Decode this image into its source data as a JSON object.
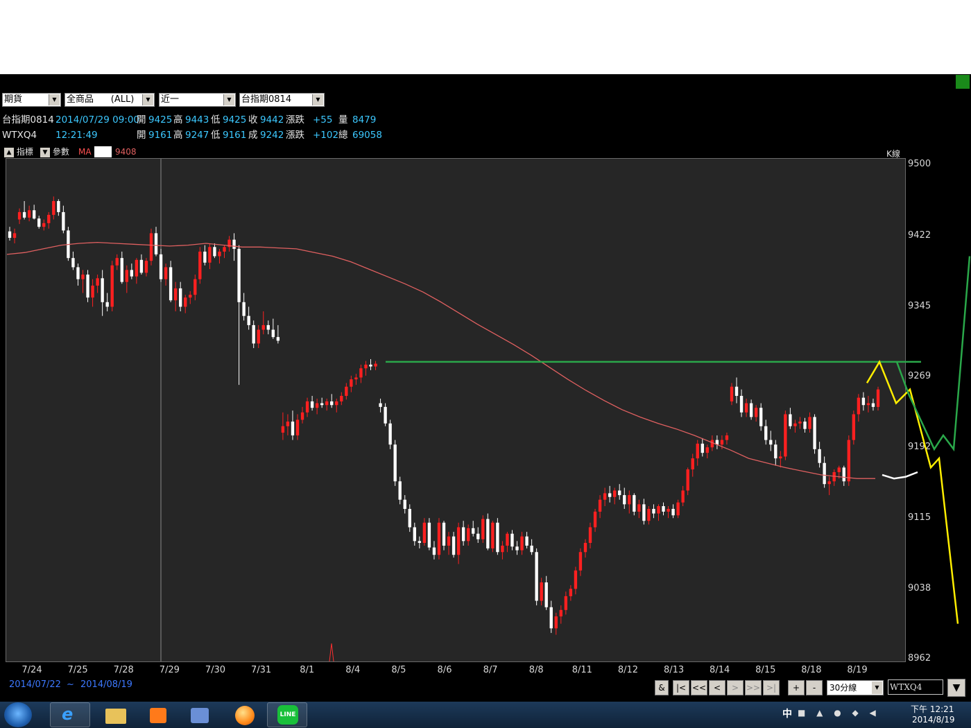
{
  "toolbar": {
    "selects": [
      "期貨",
      "全商品      (ALL)",
      "近一",
      "台指期0814"
    ]
  },
  "quote": {
    "row1": {
      "symbol": "台指期0814",
      "datetime": "2014/07/29 09:00",
      "open_label": "開",
      "open": "9425",
      "high_label": "高",
      "high": "9443",
      "low_label": "低",
      "low": "9425",
      "close_label": "收",
      "close": "9442",
      "chg_label": "漲跌",
      "chg": "+55",
      "vol_label": "量",
      "vol": "8479"
    },
    "row2": {
      "symbol": "WTXQ4",
      "time": "12:21:49",
      "open_label": "開",
      "open": "9161",
      "high_label": "高",
      "high": "9247",
      "low_label": "低",
      "low": "9161",
      "last_label": "成",
      "last": "9242",
      "chg_label": "漲跌",
      "chg": "+102",
      "vol_label": "總",
      "vol": "69058"
    }
  },
  "indicator_bar": {
    "indicator_btn": "指標",
    "param_btn": "參數",
    "ma_label": "MA",
    "ma_value": "9408",
    "kline_label": "K線"
  },
  "chart_data": {
    "type": "candlestick",
    "y_ticks": [
      "9500",
      "9422",
      "9345",
      "9269",
      "9192",
      "9115",
      "9038",
      "8962"
    ],
    "ylim": [
      8962,
      9500
    ],
    "x_ticks": [
      "7/24",
      "7/25",
      "7/28",
      "7/29",
      "7/30",
      "7/31",
      "8/1",
      "8/4",
      "8/5",
      "8/6",
      "8/7",
      "8/8",
      "8/11",
      "8/12",
      "8/13",
      "8/14",
      "8/15",
      "8/18",
      "8/19"
    ],
    "colors": {
      "up": "#ff2020",
      "down": "#ffffff",
      "ma": "#e06060",
      "resistance": "#2aa84a",
      "path_a": "#ffee00",
      "path_b": "#2aa84a",
      "bg": "#262626"
    },
    "candles": [
      [
        9427,
        9432,
        9417,
        9420
      ],
      [
        9420,
        9430,
        9414,
        9425
      ],
      [
        9440,
        9452,
        9435,
        9448
      ],
      [
        9448,
        9460,
        9440,
        9442
      ],
      [
        9442,
        9455,
        9438,
        9450
      ],
      [
        9450,
        9456,
        9440,
        9441
      ],
      [
        9441,
        9444,
        9430,
        9432
      ],
      [
        9432,
        9440,
        9428,
        9436
      ],
      [
        9436,
        9448,
        9430,
        9445
      ],
      [
        9445,
        9465,
        9440,
        9460
      ],
      [
        9460,
        9462,
        9444,
        9448
      ],
      [
        9448,
        9455,
        9425,
        9428
      ],
      [
        9428,
        9432,
        9395,
        9398
      ],
      [
        9398,
        9405,
        9385,
        9388
      ],
      [
        9388,
        9392,
        9368,
        9375
      ],
      [
        9375,
        9385,
        9360,
        9380
      ],
      [
        9380,
        9385,
        9350,
        9355
      ],
      [
        9355,
        9375,
        9345,
        9368
      ],
      [
        9368,
        9380,
        9360,
        9376
      ],
      [
        9376,
        9385,
        9335,
        9350
      ],
      [
        9350,
        9360,
        9340,
        9345
      ],
      [
        9345,
        9395,
        9340,
        9390
      ],
      [
        9390,
        9402,
        9385,
        9398
      ],
      [
        9398,
        9405,
        9370,
        9372
      ],
      [
        9372,
        9390,
        9360,
        9385
      ],
      [
        9385,
        9392,
        9375,
        9378
      ],
      [
        9378,
        9398,
        9370,
        9396
      ],
      [
        9396,
        9402,
        9380,
        9382
      ],
      [
        9382,
        9398,
        9378,
        9395
      ],
      [
        9395,
        9430,
        9390,
        9425
      ],
      [
        9425,
        9432,
        9400,
        9402
      ],
      [
        9402,
        9408,
        9372,
        9375
      ],
      [
        9375,
        9392,
        9368,
        9388
      ],
      [
        9388,
        9395,
        9350,
        9352
      ],
      [
        9352,
        9372,
        9340,
        9365
      ],
      [
        9365,
        9372,
        9340,
        9345
      ],
      [
        9345,
        9358,
        9338,
        9355
      ],
      [
        9355,
        9362,
        9348,
        9358
      ],
      [
        9358,
        9380,
        9352,
        9375
      ],
      [
        9375,
        9410,
        9370,
        9405
      ],
      [
        9405,
        9412,
        9390,
        9393
      ],
      [
        9393,
        9414,
        9386,
        9410
      ],
      [
        9410,
        9414,
        9398,
        9400
      ],
      [
        9400,
        9408,
        9392,
        9405
      ],
      [
        9405,
        9412,
        9398,
        9410
      ],
      [
        9410,
        9422,
        9405,
        9418
      ],
      [
        9418,
        9425,
        9395,
        9408
      ],
      [
        9408,
        9412,
        9260,
        9350
      ],
      [
        9350,
        9360,
        9330,
        9335
      ],
      [
        9335,
        9345,
        9320,
        9325
      ],
      [
        9325,
        9330,
        9300,
        9305
      ],
      [
        9305,
        9325,
        9300,
        9320
      ],
      [
        9320,
        9340,
        9315,
        9325
      ],
      [
        9325,
        9330,
        9315,
        9320
      ],
      [
        9320,
        9332,
        9310,
        9312
      ],
      [
        9312,
        9325,
        9305,
        9308
      ],
      [
        9208,
        9230,
        9200,
        9215
      ],
      [
        9215,
        9228,
        9205,
        9220
      ],
      [
        9220,
        9232,
        9200,
        9205
      ],
      [
        9205,
        9228,
        9200,
        9222
      ],
      [
        9222,
        9236,
        9218,
        9230
      ],
      [
        9230,
        9246,
        9225,
        9242
      ],
      [
        9242,
        9248,
        9232,
        9235
      ],
      [
        9235,
        9245,
        9228,
        9240
      ],
      [
        9240,
        9246,
        9235,
        9238
      ],
      [
        9238,
        9245,
        9232,
        9242
      ],
      [
        9242,
        9250,
        9235,
        9238
      ],
      [
        9238,
        9245,
        9230,
        9242
      ],
      [
        9242,
        9252,
        9238,
        9248
      ],
      [
        9248,
        9262,
        9244,
        9258
      ],
      [
        9258,
        9270,
        9252,
        9266
      ],
      [
        9266,
        9272,
        9260,
        9268
      ],
      [
        9268,
        9282,
        9262,
        9278
      ],
      [
        9278,
        9286,
        9270,
        9282
      ],
      [
        9282,
        9288,
        9276,
        9280
      ],
      [
        9280,
        9286,
        9276,
        9283
      ],
      [
        9240,
        9245,
        9230,
        9236
      ],
      [
        9236,
        9240,
        9215,
        9218
      ],
      [
        9218,
        9222,
        9190,
        9195
      ],
      [
        9195,
        9200,
        9150,
        9155
      ],
      [
        9155,
        9160,
        9130,
        9135
      ],
      [
        9135,
        9140,
        9120,
        9125
      ],
      [
        9125,
        9130,
        9100,
        9105
      ],
      [
        9105,
        9110,
        9085,
        9090
      ],
      [
        9090,
        9095,
        9082,
        9088
      ],
      [
        9088,
        9115,
        9085,
        9110
      ],
      [
        9110,
        9115,
        9080,
        9083
      ],
      [
        9083,
        9090,
        9070,
        9075
      ],
      [
        9075,
        9115,
        9070,
        9110
      ],
      [
        9110,
        9112,
        9080,
        9085
      ],
      [
        9085,
        9100,
        9075,
        9095
      ],
      [
        9095,
        9100,
        9072,
        9075
      ],
      [
        9075,
        9110,
        9065,
        9105
      ],
      [
        9105,
        9112,
        9085,
        9090
      ],
      [
        9090,
        9108,
        9085,
        9104
      ],
      [
        9104,
        9112,
        9095,
        9098
      ],
      [
        9098,
        9105,
        9088,
        9092
      ],
      [
        9092,
        9118,
        9088,
        9114
      ],
      [
        9114,
        9120,
        9080,
        9082
      ],
      [
        9082,
        9112,
        9078,
        9110
      ],
      [
        9110,
        9115,
        9075,
        9078
      ],
      [
        9078,
        9090,
        9070,
        9085
      ],
      [
        9085,
        9100,
        9078,
        9098
      ],
      [
        9098,
        9102,
        9080,
        9084
      ],
      [
        9084,
        9090,
        9075,
        9080
      ],
      [
        9080,
        9100,
        9075,
        9095
      ],
      [
        9095,
        9100,
        9082,
        9085
      ],
      [
        9085,
        9092,
        9075,
        9078
      ],
      [
        9078,
        9082,
        9020,
        9025
      ],
      [
        9025,
        9050,
        9020,
        9045
      ],
      [
        9045,
        9052,
        9015,
        9018
      ],
      [
        9018,
        9025,
        8990,
        8995
      ],
      [
        8995,
        9012,
        8988,
        9008
      ],
      [
        9008,
        9020,
        9000,
        9015
      ],
      [
        9015,
        9035,
        9010,
        9030
      ],
      [
        9030,
        9042,
        9025,
        9038
      ],
      [
        9038,
        9062,
        9032,
        9058
      ],
      [
        9058,
        9082,
        9052,
        9078
      ],
      [
        9078,
        9092,
        9072,
        9088
      ],
      [
        9088,
        9110,
        9082,
        9105
      ],
      [
        9105,
        9125,
        9100,
        9122
      ],
      [
        9122,
        9140,
        9115,
        9135
      ],
      [
        9135,
        9148,
        9128,
        9142
      ],
      [
        9142,
        9150,
        9132,
        9138
      ],
      [
        9138,
        9148,
        9130,
        9145
      ],
      [
        9145,
        9152,
        9135,
        9140
      ],
      [
        9140,
        9148,
        9125,
        9130
      ],
      [
        9130,
        9145,
        9120,
        9140
      ],
      [
        9140,
        9142,
        9118,
        9122
      ],
      [
        9122,
        9135,
        9115,
        9130
      ],
      [
        9130,
        9136,
        9108,
        9112
      ],
      [
        9112,
        9128,
        9108,
        9125
      ],
      [
        9125,
        9130,
        9115,
        9120
      ],
      [
        9120,
        9130,
        9112,
        9128
      ],
      [
        9128,
        9132,
        9118,
        9122
      ],
      [
        9122,
        9128,
        9115,
        9125
      ],
      [
        9125,
        9130,
        9115,
        9118
      ],
      [
        9118,
        9135,
        9115,
        9132
      ],
      [
        9132,
        9150,
        9128,
        9145
      ],
      [
        9145,
        9170,
        9140,
        9168
      ],
      [
        9168,
        9185,
        9160,
        9180
      ],
      [
        9180,
        9200,
        9172,
        9196
      ],
      [
        9196,
        9202,
        9182,
        9186
      ],
      [
        9186,
        9195,
        9180,
        9192
      ],
      [
        9192,
        9205,
        9188,
        9200
      ],
      [
        9200,
        9205,
        9190,
        9195
      ],
      [
        9195,
        9205,
        9190,
        9200
      ],
      [
        9200,
        9208,
        9195,
        9205
      ],
      [
        9242,
        9262,
        9238,
        9258
      ],
      [
        9258,
        9268,
        9240,
        9248
      ],
      [
        9248,
        9255,
        9225,
        9230
      ],
      [
        9230,
        9245,
        9225,
        9240
      ],
      [
        9240,
        9244,
        9222,
        9225
      ],
      [
        9225,
        9238,
        9220,
        9235
      ],
      [
        9235,
        9240,
        9210,
        9215
      ],
      [
        9215,
        9222,
        9195,
        9200
      ],
      [
        9200,
        9210,
        9188,
        9195
      ],
      [
        9195,
        9200,
        9172,
        9180
      ],
      [
        9180,
        9188,
        9170,
        9182
      ],
      [
        9182,
        9232,
        9178,
        9228
      ],
      [
        9228,
        9235,
        9212,
        9215
      ],
      [
        9215,
        9222,
        9208,
        9218
      ],
      [
        9218,
        9225,
        9212,
        9220
      ],
      [
        9220,
        9224,
        9208,
        9212
      ],
      [
        9212,
        9230,
        9208,
        9225
      ],
      [
        9225,
        9228,
        9185,
        9190
      ],
      [
        9190,
        9198,
        9170,
        9175
      ],
      [
        9175,
        9182,
        9148,
        9152
      ],
      [
        9152,
        9160,
        9140,
        9155
      ],
      [
        9155,
        9168,
        9150,
        9165
      ],
      [
        9165,
        9172,
        9158,
        9170
      ],
      [
        9170,
        9172,
        9150,
        9155
      ],
      [
        9155,
        9205,
        9150,
        9200
      ],
      [
        9200,
        9232,
        9195,
        9228
      ],
      [
        9228,
        9250,
        9220,
        9246
      ],
      [
        9246,
        9252,
        9232,
        9238
      ],
      [
        9238,
        9248,
        9230,
        9240
      ],
      [
        9240,
        9245,
        9232,
        9236
      ],
      [
        9236,
        9258,
        9232,
        9255
      ]
    ],
    "ma_line": [
      [
        9402,
        9404,
        9408,
        9412,
        9414,
        9415,
        9414,
        9413,
        9412,
        9411,
        9412,
        9414,
        9412,
        9410,
        9410,
        9409,
        9408,
        9404,
        9400,
        9394,
        9386,
        9378,
        9370,
        9361,
        9350,
        9338,
        9326,
        9315,
        9304,
        9292,
        9279,
        9266,
        9254,
        9243,
        9233,
        9225,
        9218,
        9212,
        9205,
        9197,
        9189,
        9180,
        9175,
        9170,
        9166,
        9162,
        9160,
        9158,
        9158
      ]
    ],
    "resistance_level": 9285,
    "projection_a": [
      [
        9262,
        9285
      ],
      [
        9285,
        9240
      ],
      [
        9240,
        9255
      ],
      [
        9255,
        9170
      ],
      [
        9170,
        9180
      ],
      [
        9180,
        9000
      ]
    ],
    "projection_b": [
      [
        9285,
        9250
      ],
      [
        9250,
        9190
      ],
      [
        9190,
        9205
      ],
      [
        9205,
        9190
      ],
      [
        9190,
        9400
      ]
    ],
    "white_curve": [
      9162,
      9158,
      9160,
      9165
    ]
  },
  "footer": {
    "date_from": "2014/07/22",
    "tilde": "~",
    "date_to": "2014/08/19",
    "nav_buttons": [
      "&",
      "|<",
      "<<",
      "<",
      ">",
      ">>",
      ">|",
      "+",
      "-"
    ],
    "period": "30分線",
    "symbol_input": "WTXQ4"
  },
  "taskbar": {
    "ime": "中",
    "clock_time": "下午 12:21",
    "clock_date": "2014/8/19"
  }
}
